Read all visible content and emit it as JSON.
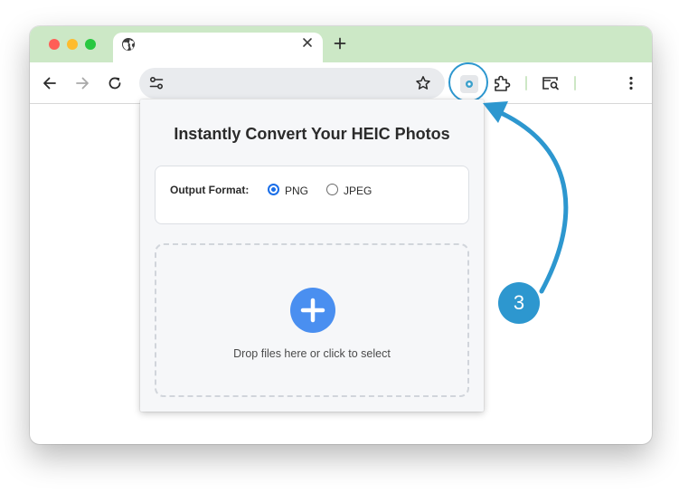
{
  "browser": {
    "tab": {
      "title": "",
      "icon": "globe-icon"
    },
    "toolbar": {
      "url": "",
      "icons": [
        "back-arrow-icon",
        "forward-arrow-icon",
        "reload-icon",
        "tune-icon",
        "star-icon",
        "extension-icon",
        "puzzle-icon",
        "tab-search-icon",
        "more-vert-icon"
      ]
    }
  },
  "popup": {
    "title": "Instantly Convert Your HEIC Photos",
    "output_format": {
      "label": "Output Format:",
      "options": [
        {
          "label": "PNG",
          "checked": true
        },
        {
          "label": "JPEG",
          "checked": false
        }
      ]
    },
    "dropzone": {
      "text": "Drop files here or click to select",
      "icon": "plus-icon"
    }
  },
  "annotation": {
    "step_number": "3",
    "color": "#2d97cf"
  },
  "colors": {
    "tabstrip": "#cce8c6",
    "accent_blue": "#4a8ff0",
    "radio_blue": "#1a6ee8"
  }
}
